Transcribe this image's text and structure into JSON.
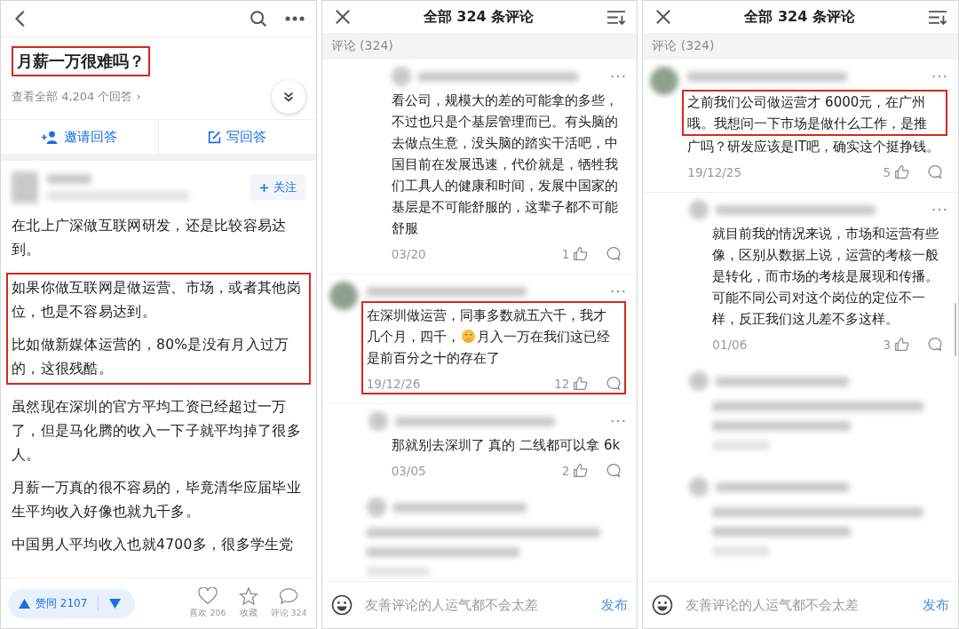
{
  "answer_page": {
    "title": {
      "text": "月薪一万很难吗？",
      "highlighted": true
    },
    "view_all": "查看全部 4,204 个回答 ›",
    "actions": [
      {
        "kind": "invite",
        "label": "邀请回答"
      },
      {
        "kind": "write",
        "label": "写回答"
      }
    ],
    "follow_button": "关注",
    "blocks": [
      {
        "highlighted": false,
        "paragraphs": [
          "在北上广深做互联网研发，还是比较容易达到。"
        ]
      },
      {
        "highlighted": true,
        "paragraphs": [
          "如果你做互联网是做运营、市场，或者其他岗位，也是不容易达到。",
          "比如做新媒体运营的，80%是没有月入过万的，这很残酷。"
        ]
      },
      {
        "highlighted": false,
        "paragraphs": [
          "虽然现在深圳的官方平均工资已经超过一万了，但是马化腾的收入一下子就平均掉了很多人。",
          "月薪一万真的很不容易的，毕竟清华应届毕业生平均收入好像也就九千多。",
          "中国男人平均收入也就4700多，很多学生党"
        ]
      }
    ],
    "vote": "赞同 2107",
    "bottom_actions": [
      {
        "kind": "like",
        "label": "喜欢 206"
      },
      {
        "kind": "favorite",
        "label": "收藏"
      },
      {
        "kind": "comment",
        "label": "评论 324"
      }
    ]
  },
  "comment_pages": [
    {
      "title": "全部 324 条评论",
      "section": "评论 (324)",
      "comments": [
        {
          "kind": "reply",
          "highlighted": false,
          "segments": [
            {
              "text": "看公司，规模大的差的可能拿的多些，不过也只是个基层管理而已。有头脑的去做点生意，没头脑的踏实干活吧，中国目前在发展迅速，代价就是，牺牲我们工具人的健康和时间，发展中国家的基层是不可能舒服的，这辈子都不可能舒服",
              "highlighted": false
            }
          ],
          "date": "03/20",
          "likes": "1"
        },
        {
          "kind": "comment",
          "highlighted": true,
          "segments": [
            {
              "kind": "line",
              "text": "在深圳做运营，同事多数就五六千，我才",
              "highlighted": false
            },
            {
              "kind": "line",
              "text": "几个月，四千，",
              "highlighted": false
            },
            {
              "kind": "emoji"
            },
            {
              "kind": "line",
              "text": "月入一万在我们这已经",
              "highlighted": false
            },
            {
              "kind": "line",
              "text": "是前百分之十的存在了",
              "highlighted": false
            }
          ],
          "date": "19/12/26",
          "likes": "12",
          "children": [
            {
              "kind": "reply",
              "highlighted": false,
              "segments": [
                {
                  "text": "那就别去深圳了 真的 二线都可以拿 6k",
                  "highlighted": false
                }
              ],
              "date": "03/05",
              "likes": "2"
            }
          ]
        },
        {
          "kind": "blurred"
        }
      ],
      "input": {
        "placeholder": "友善评论的人运气都不会太差"
      },
      "submit": "发布"
    },
    {
      "title": "全部 324 条评论",
      "section": "评论 (324)",
      "comments": [
        {
          "kind": "comment",
          "highlighted": false,
          "segments": [
            {
              "text": "之前我们公司做运营才 6000元，在广州哦。我想问一下市场是做什么工作，是推",
              "highlighted": true
            },
            {
              "text": "广吗？研发应该是IT吧，确实这个挺挣钱。",
              "highlighted": false
            }
          ],
          "date": "19/12/25",
          "likes": "5",
          "children": [
            {
              "kind": "reply",
              "highlighted": false,
              "segments": [
                {
                  "text": "就目前我的情况来说，市场和运营有些像，区别从数据上说，运营的考核一般是转化，而市场的考核是展现和传播。可能不同公司对这个岗位的定位不一样，反正我们这儿差不多这样。",
                  "highlighted": false
                }
              ],
              "date": "01/06",
              "likes": "3"
            },
            {
              "kind": "blurred"
            },
            {
              "kind": "blurred"
            }
          ]
        }
      ],
      "input": {
        "placeholder": "友善评论的人运气都不会太差"
      },
      "submit": "发布"
    }
  ]
}
